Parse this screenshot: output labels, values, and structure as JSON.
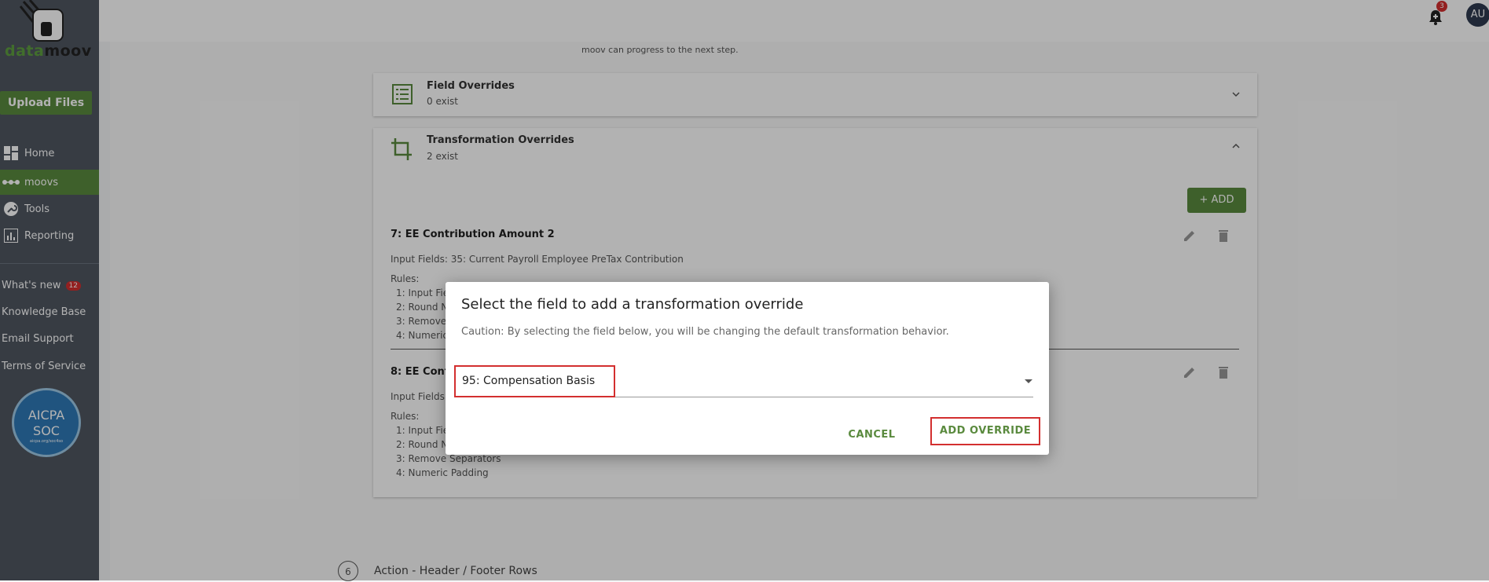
{
  "brand": {
    "name_part1": "data",
    "name_part2": "moov"
  },
  "sidebar": {
    "upload_label": "Upload Files",
    "nav": [
      {
        "label": "Home",
        "icon": "dashboard-icon"
      },
      {
        "label": "moovs",
        "icon": "moovs-dots-icon",
        "active": true
      },
      {
        "label": "Tools",
        "icon": "wrench-icon"
      },
      {
        "label": "Reporting",
        "icon": "chart-icon"
      }
    ],
    "links": [
      {
        "label": "What's new",
        "badge": "12"
      },
      {
        "label": "Knowledge Base"
      },
      {
        "label": "Email Support"
      },
      {
        "label": "Terms of Service"
      }
    ],
    "aicpa": {
      "line1": "AICPA",
      "line2": "SOC",
      "line3": "aicpa.org/soc4so"
    }
  },
  "topbar": {
    "notification_count": "3",
    "avatar_initials": "AU"
  },
  "content": {
    "prev_text": "moov can progress to the next step.",
    "field_overrides": {
      "title": "Field Overrides",
      "subtitle": "0 exist"
    },
    "transformation_overrides": {
      "title": "Transformation Overrides",
      "subtitle": "2 exist",
      "add_label": "+ ADD"
    },
    "rules": [
      {
        "title": "7: EE Contribution Amount 2",
        "input_fields": "Input Fields: 35: Current Payroll Employee PreTax Contribution",
        "rules_label": "Rules:",
        "items": [
          "1: Input Fie",
          "2: Round N",
          "3: Remove",
          "4: Numeric"
        ]
      },
      {
        "title": "8: EE Cont",
        "input_fields": "Input Fields",
        "rules_label": "Rules:",
        "items": [
          "1: Input Fie",
          "2: Round N",
          "3: Remove Separators",
          "4: Numeric Padding"
        ]
      }
    ],
    "step": {
      "number": "6",
      "label": "Action - Header / Footer Rows"
    }
  },
  "modal": {
    "title": "Select the field to add a transformation override",
    "caution": "Caution: By selecting the field below, you will be changing the default transformation behavior.",
    "selected_value": "95: Compensation Basis",
    "cancel_label": "CANCEL",
    "add_label": "ADD OVERRIDE"
  },
  "colors": {
    "accent": "#5a8a3e",
    "highlight": "#d32f2f",
    "sidebar_bg": "#4f5661"
  }
}
